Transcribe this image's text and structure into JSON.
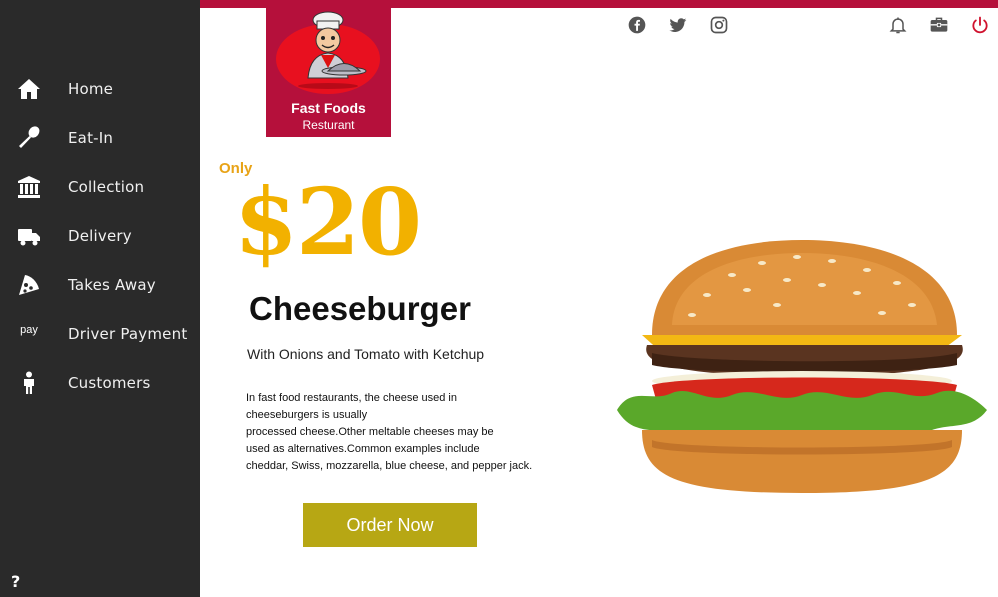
{
  "sidebar": {
    "items": [
      {
        "label": "Home",
        "icon": "home-icon"
      },
      {
        "label": "Eat-In",
        "icon": "spoon-icon"
      },
      {
        "label": "Collection",
        "icon": "bank-icon"
      },
      {
        "label": "Delivery",
        "icon": "truck-icon"
      },
      {
        "label": "Takes Away",
        "icon": "pizza-icon"
      },
      {
        "label": "Driver Payment",
        "icon": "amazon-pay-icon"
      },
      {
        "label": "Customers",
        "icon": "person-icon"
      }
    ],
    "pay_icon_text": "pay",
    "help_label": "?"
  },
  "brand": {
    "name": "Fast Foods",
    "subtitle": "Resturant",
    "color": "#b5103b"
  },
  "promo": {
    "only": "Only",
    "price": "$20",
    "product": "Cheeseburger",
    "subtitle": "With Onions and Tomato with Ketchup",
    "description": "In fast food restaurants, the cheese used in\ncheeseburgers is usually\nprocessed cheese.Other meltable cheeses may be\n used as alternatives.Common examples include\ncheddar, Swiss, mozzarella, blue cheese, and pepper jack.",
    "order_label": "Order Now",
    "price_color": "#f2b100",
    "button_color": "#b7a714"
  },
  "social_icons": [
    "facebook-icon",
    "twitter-icon",
    "instagram-icon"
  ],
  "action_icons": [
    "bell-icon",
    "toolbox-icon",
    "power-icon"
  ]
}
